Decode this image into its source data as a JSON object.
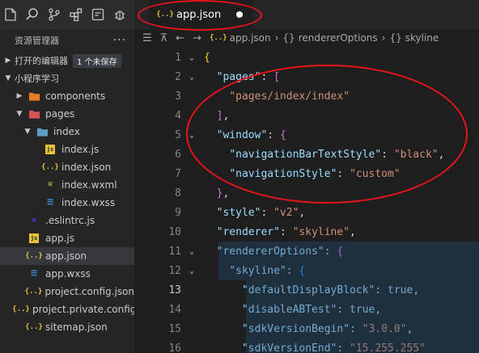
{
  "sidebar": {
    "activity_icons": [
      "files-icon",
      "search-icon",
      "source-control-icon",
      "extensions-icon",
      "wechat-devtools-icon",
      "debug-icon"
    ],
    "title": "资源管理器",
    "more": "···",
    "open_editors": {
      "label": "打开的编辑器",
      "badge": "1 个未保存"
    },
    "project": {
      "label": "小程序学习"
    },
    "tree": [
      {
        "label": "components",
        "type": "folder",
        "depth": 1,
        "expanded": false
      },
      {
        "label": "pages",
        "type": "folder",
        "depth": 1,
        "expanded": true
      },
      {
        "label": "index",
        "type": "folder",
        "depth": 2,
        "expanded": true
      },
      {
        "label": "index.js",
        "type": "js",
        "depth": 3
      },
      {
        "label": "index.json",
        "type": "json",
        "depth": 3
      },
      {
        "label": "index.wxml",
        "type": "wxml",
        "depth": 3
      },
      {
        "label": "index.wxss",
        "type": "wxss",
        "depth": 3
      },
      {
        "label": ".eslintrc.js",
        "type": "eslint",
        "depth": 1
      },
      {
        "label": "app.js",
        "type": "js",
        "depth": 1
      },
      {
        "label": "app.json",
        "type": "json",
        "depth": 1,
        "selected": true
      },
      {
        "label": "app.wxss",
        "type": "wxss",
        "depth": 1
      },
      {
        "label": "project.config.json",
        "type": "json",
        "depth": 1
      },
      {
        "label": "project.private.config.js...",
        "type": "json",
        "depth": 1
      },
      {
        "label": "sitemap.json",
        "type": "json",
        "depth": 1
      }
    ]
  },
  "tab": {
    "icon": "{..}",
    "label": "app.json"
  },
  "breadcrumb": {
    "items": [
      "app.json",
      "rendererOptions",
      "skyline"
    ],
    "prefixes": [
      "{..}",
      "{}",
      "{}"
    ]
  },
  "editor": {
    "active_line": 13,
    "lines": [
      {
        "n": "1",
        "fold": "v",
        "tokens": [
          [
            "b1",
            "{"
          ]
        ]
      },
      {
        "n": "2",
        "fold": "v",
        "tokens": [
          [
            "p",
            "  "
          ],
          [
            "k",
            "\"pages\""
          ],
          [
            "p",
            ": "
          ],
          [
            "b2",
            "["
          ]
        ]
      },
      {
        "n": "3",
        "fold": "",
        "tokens": [
          [
            "p",
            "    "
          ],
          [
            "s",
            "\"pages/index/index\""
          ]
        ]
      },
      {
        "n": "4",
        "fold": "",
        "tokens": [
          [
            "p",
            "  "
          ],
          [
            "b2",
            "]"
          ],
          [
            "p",
            ","
          ]
        ]
      },
      {
        "n": "5",
        "fold": "v",
        "tokens": [
          [
            "p",
            "  "
          ],
          [
            "k",
            "\"window\""
          ],
          [
            "p",
            ": "
          ],
          [
            "b2",
            "{"
          ]
        ]
      },
      {
        "n": "6",
        "fold": "",
        "tokens": [
          [
            "p",
            "    "
          ],
          [
            "k",
            "\"navigationBarTextStyle\""
          ],
          [
            "p",
            ": "
          ],
          [
            "s",
            "\"black\""
          ],
          [
            "p",
            ","
          ]
        ]
      },
      {
        "n": "7",
        "fold": "",
        "tokens": [
          [
            "p",
            "    "
          ],
          [
            "k",
            "\"navigationStyle\""
          ],
          [
            "p",
            ": "
          ],
          [
            "s",
            "\"custom\""
          ]
        ]
      },
      {
        "n": "8",
        "fold": "",
        "tokens": [
          [
            "p",
            "  "
          ],
          [
            "b2",
            "}"
          ],
          [
            "p",
            ","
          ]
        ]
      },
      {
        "n": "9",
        "fold": "",
        "tokens": [
          [
            "p",
            "  "
          ],
          [
            "k",
            "\"style\""
          ],
          [
            "p",
            ": "
          ],
          [
            "s",
            "\"v2\""
          ],
          [
            "p",
            ","
          ]
        ]
      },
      {
        "n": "10",
        "fold": "",
        "tokens": [
          [
            "p",
            "  "
          ],
          [
            "k",
            "\"renderer\""
          ],
          [
            "p",
            ": "
          ],
          [
            "s",
            "\"skyline\""
          ],
          [
            "p",
            ","
          ]
        ]
      },
      {
        "n": "11",
        "fold": "v",
        "tokens": [
          [
            "p",
            "  "
          ],
          [
            "k",
            "\"rendererOptions\""
          ],
          [
            "p",
            ": "
          ],
          [
            "b2",
            "{"
          ]
        ]
      },
      {
        "n": "12",
        "fold": "v",
        "tokens": [
          [
            "p",
            "    "
          ],
          [
            "k",
            "\"skyline\""
          ],
          [
            "p",
            ": "
          ],
          [
            "b3",
            "{"
          ]
        ]
      },
      {
        "n": "13",
        "fold": "",
        "tokens": [
          [
            "p",
            "      "
          ],
          [
            "k",
            "\"defaultDisplayBlock\""
          ],
          [
            "p",
            ": "
          ],
          [
            "k",
            "true"
          ],
          [
            "p",
            ","
          ]
        ]
      },
      {
        "n": "14",
        "fold": "",
        "tokens": [
          [
            "p",
            "      "
          ],
          [
            "k",
            "\"disableABTest\""
          ],
          [
            "p",
            ": "
          ],
          [
            "k",
            "true"
          ],
          [
            "p",
            ","
          ]
        ]
      },
      {
        "n": "15",
        "fold": "",
        "tokens": [
          [
            "p",
            "      "
          ],
          [
            "k",
            "\"sdkVersionBegin\""
          ],
          [
            "p",
            ": "
          ],
          [
            "s",
            "\"3.0.0\""
          ],
          [
            "p",
            ","
          ]
        ]
      },
      {
        "n": "16",
        "fold": "",
        "tokens": [
          [
            "p",
            "      "
          ],
          [
            "k",
            "\"sdkVersionEnd\""
          ],
          [
            "p",
            ": "
          ],
          [
            "s",
            "\"15.255.255\""
          ]
        ]
      }
    ]
  },
  "colors": {
    "annotation": "#e8141b",
    "selection": "#264f78",
    "key": "#9cdcfe",
    "string": "#ce9178"
  }
}
